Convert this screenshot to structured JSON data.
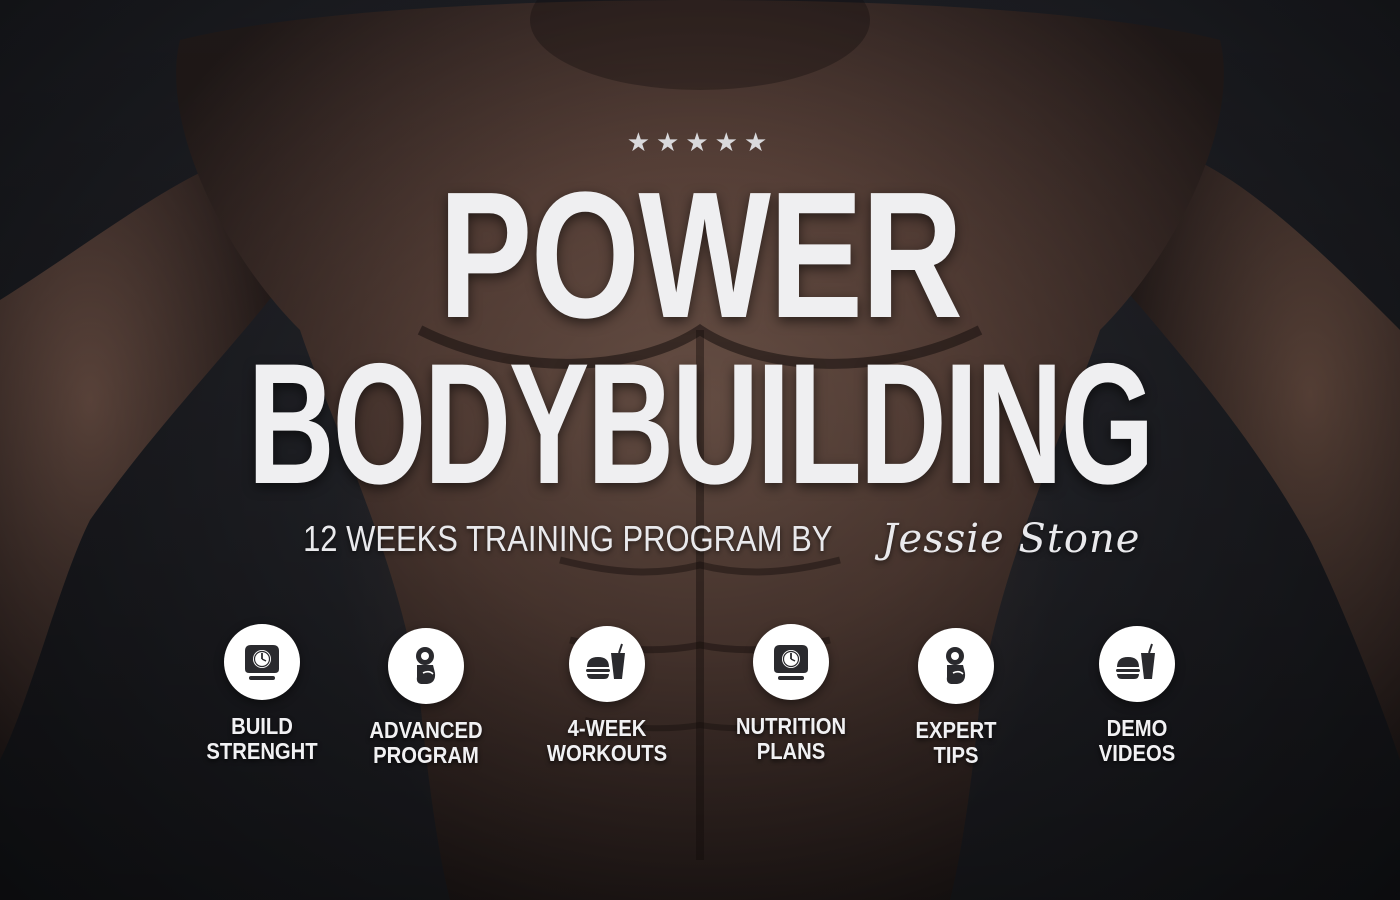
{
  "stars": "★★★★★",
  "title": {
    "line1": "POWER",
    "line2": "BODYBUILDING"
  },
  "subtitle": {
    "text": "12 WEEKS TRAINING PROGRAM BY",
    "author": "Jessie Stone"
  },
  "features": [
    {
      "icon": "scale-icon",
      "line1": "BUILD",
      "line2": "STRENGHT"
    },
    {
      "icon": "flexed-arm-icon",
      "line1": "ADVANCED",
      "line2": "PROGRAM"
    },
    {
      "icon": "burger-drink-icon",
      "line1": "4-WEEK",
      "line2": "WORKOUTS"
    },
    {
      "icon": "scale-icon",
      "line1": "NUTRITION",
      "line2": "PLANS"
    },
    {
      "icon": "flexed-arm-icon",
      "line1": "EXPERT",
      "line2": "TIPS"
    },
    {
      "icon": "burger-drink-icon",
      "line1": "DEMO",
      "line2": "VIDEOS"
    }
  ],
  "colors": {
    "background": "#1b1c20",
    "text": "#efeff1",
    "icon_circle": "#ffffff",
    "icon_glyph": "#2a2a2e"
  }
}
